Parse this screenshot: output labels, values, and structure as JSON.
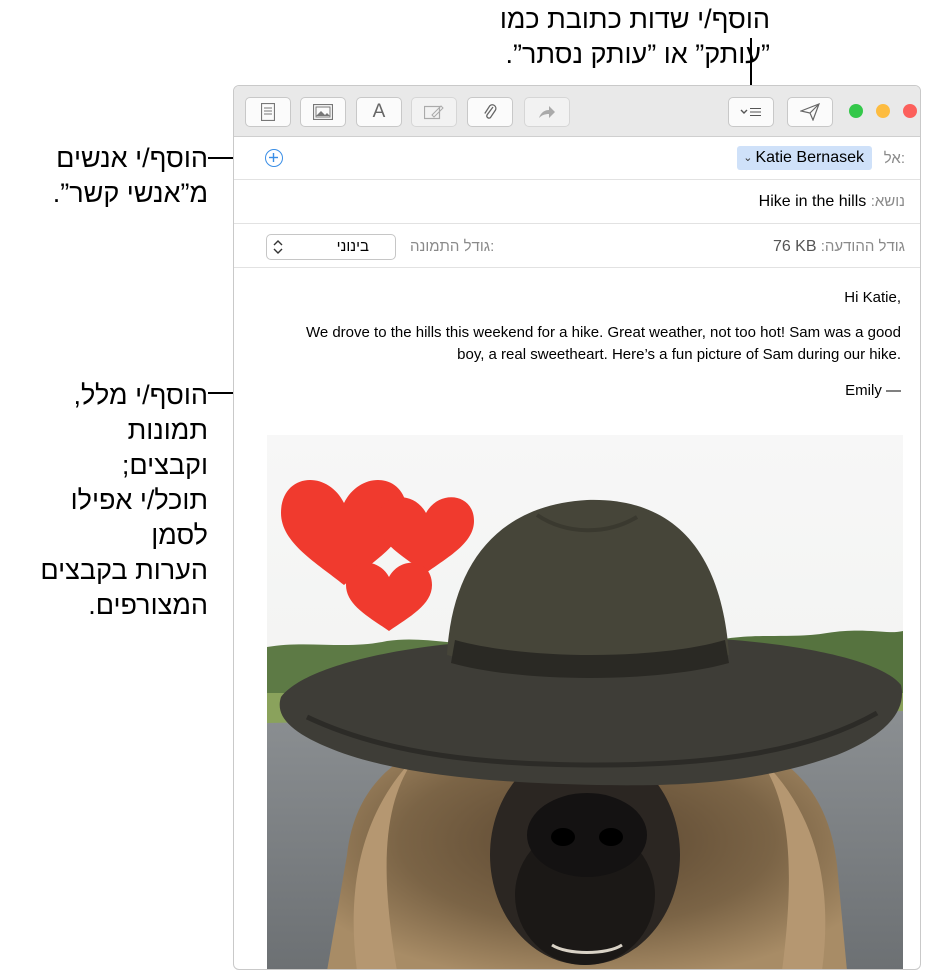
{
  "annotations": {
    "fields": [
      "הוסף/י שדות כתובת כמו",
      "”עותק” או ”עותק נסתר”."
    ],
    "contacts": [
      "הוסף/י אנשים",
      "מ”אנשי קשר”."
    ],
    "content": [
      "הוסף/י מלל,",
      "תמונות וקבצים;",
      "תוכל/י אפילו לסמן",
      "הערות בקבצים",
      "המצורפים."
    ]
  },
  "toolbar": {
    "icons": [
      "header-fields-icon",
      "photo-browser-icon",
      "format-icon",
      "markup-icon",
      "attachment-icon",
      "send-icon"
    ],
    "format_label": "A",
    "colors": {
      "close": "#fc605c",
      "minimize": "#fdbc40",
      "zoom": "#34c84a"
    }
  },
  "header": {
    "to_label": "אל:",
    "to_recipient": "Katie Bernasek",
    "subject_label": "נושא:",
    "subject": "Hike in the hills",
    "message_size_label": "גודל ההודעה:",
    "message_size": "76 KB",
    "image_size_label": "גודל התמונה:",
    "image_size_value": "בינוני"
  },
  "body": {
    "greeting": "Hi Katie,",
    "paragraph_line1": "We drove to the hills this weekend for a hike. Great weather, not too hot! Sam was a good",
    "paragraph_line2": "boy, a real sweetheart. Here’s a fun picture of Sam during our hike.",
    "signature": "Emily —"
  },
  "accent_color": "#3a8ee6"
}
